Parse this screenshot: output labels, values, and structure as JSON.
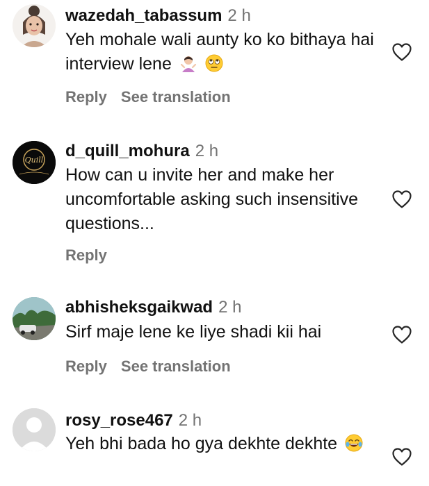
{
  "comments": [
    {
      "username": "wazedah_tabassum",
      "time": "2 h",
      "text": "Yeh mohale wali aunty ko ko bithaya hai interview lene",
      "emojis": [
        "person-shrugging-emoji",
        "eye-roll-emoji"
      ],
      "actions": [
        "Reply",
        "See translation"
      ]
    },
    {
      "username": "d_quill_mohura",
      "time": "2 h",
      "text": "How can u invite her and make her uncomfortable asking such insensitive questions...",
      "avatar_text": "Quill",
      "actions": [
        "Reply"
      ]
    },
    {
      "username": "abhisheksgaikwad",
      "time": "2 h",
      "text": "Sirf maje lene ke liye shadi kii hai",
      "actions": [
        "Reply",
        "See translation"
      ]
    },
    {
      "username": "rosy_rose467",
      "time": "2 h",
      "text": "Yeh bhi bada ho gya dekhte dekhte",
      "emojis": [
        "tears-of-joy-emoji"
      ]
    }
  ],
  "colors": {
    "muted": "#737373",
    "text": "#111111"
  },
  "icons": [
    "heart-outline-icon",
    "avatar-placeholder-icon"
  ]
}
